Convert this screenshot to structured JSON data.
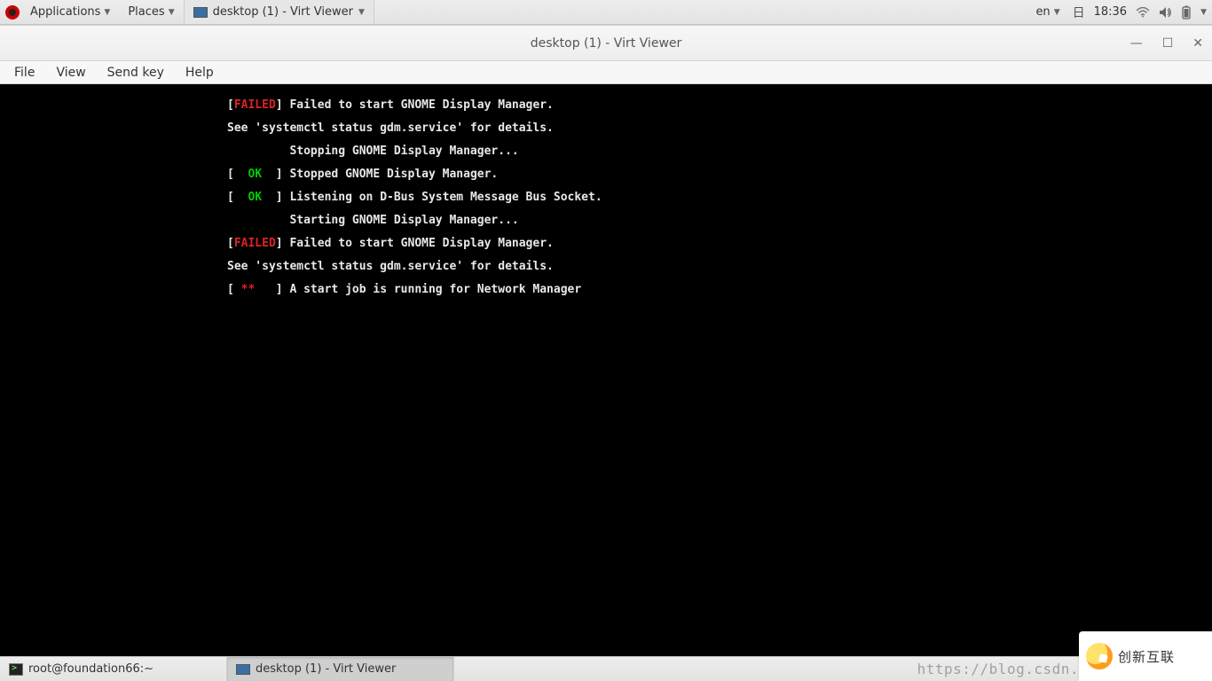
{
  "panel": {
    "applications": "Applications",
    "places": "Places",
    "taskWindow": "desktop (1) - Virt Viewer",
    "lang": "en",
    "day": "日",
    "time": "18:36"
  },
  "window": {
    "title": "desktop (1) - Virt Viewer",
    "menu": {
      "file": "File",
      "view": "View",
      "sendkey": "Send key",
      "help": "Help"
    }
  },
  "console": {
    "l1_tag": "FAILED",
    "l1_msg": "] Failed to start GNOME Display Manager.",
    "l2": "See 'systemctl status gdm.service' for details.",
    "l3": "         Stopping GNOME Display Manager...",
    "l4_tag": "OK",
    "l4_msg": "] Stopped GNOME Display Manager.",
    "l5_tag": "OK",
    "l5_msg": "] Listening on D-Bus System Message Bus Socket.",
    "l6": "         Starting GNOME Display Manager...",
    "l7_tag": "FAILED",
    "l7_msg": "] Failed to start GNOME Display Manager.",
    "l8": "See 'systemctl status gdm.service' for details.",
    "l9_spin": "**",
    "l9_msg": "] A start job is running for Network Manager"
  },
  "taskbar": {
    "term": "root@foundation66:~",
    "virt": "desktop (1) - Virt Viewer"
  },
  "watermark": "https://blog.csdn.",
  "brand": "创新互联"
}
